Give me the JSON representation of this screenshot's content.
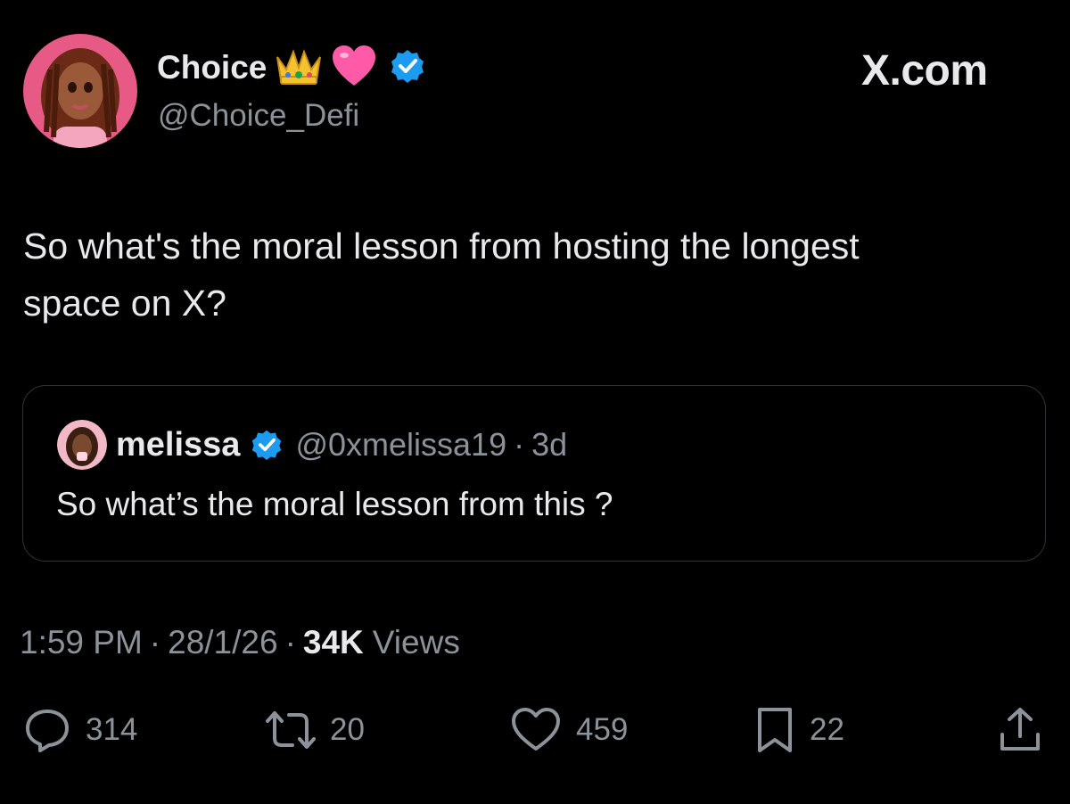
{
  "author": {
    "name": "Choice",
    "emojis": [
      "crown",
      "pink-heart"
    ],
    "handle": "@Choice_Defi",
    "verified": true
  },
  "brand": "X.com",
  "tweet": {
    "text_line1": "So what's the moral lesson from hosting the longest",
    "text_line2": "space on X?"
  },
  "quoted": {
    "name": "melissa",
    "handle": "@0xmelissa19",
    "separator": "·",
    "age": "3d",
    "text": "So what’s the moral lesson from this ?"
  },
  "meta": {
    "time": "1:59 PM",
    "sep1": "·",
    "date": "28/1/26",
    "sep2": "·",
    "views_count": "34K",
    "views_label": "Views"
  },
  "actions": {
    "replies": "314",
    "reposts": "20",
    "likes": "459",
    "bookmarks": "22"
  },
  "colors": {
    "background": "#000000",
    "text": "#e7e9ea",
    "muted": "#8b9299",
    "verified": "#1d9bf0",
    "border": "#2f3336"
  },
  "icons": [
    "verified-badge-icon",
    "reply-icon",
    "repost-icon",
    "like-icon",
    "bookmark-icon",
    "share-icon"
  ]
}
